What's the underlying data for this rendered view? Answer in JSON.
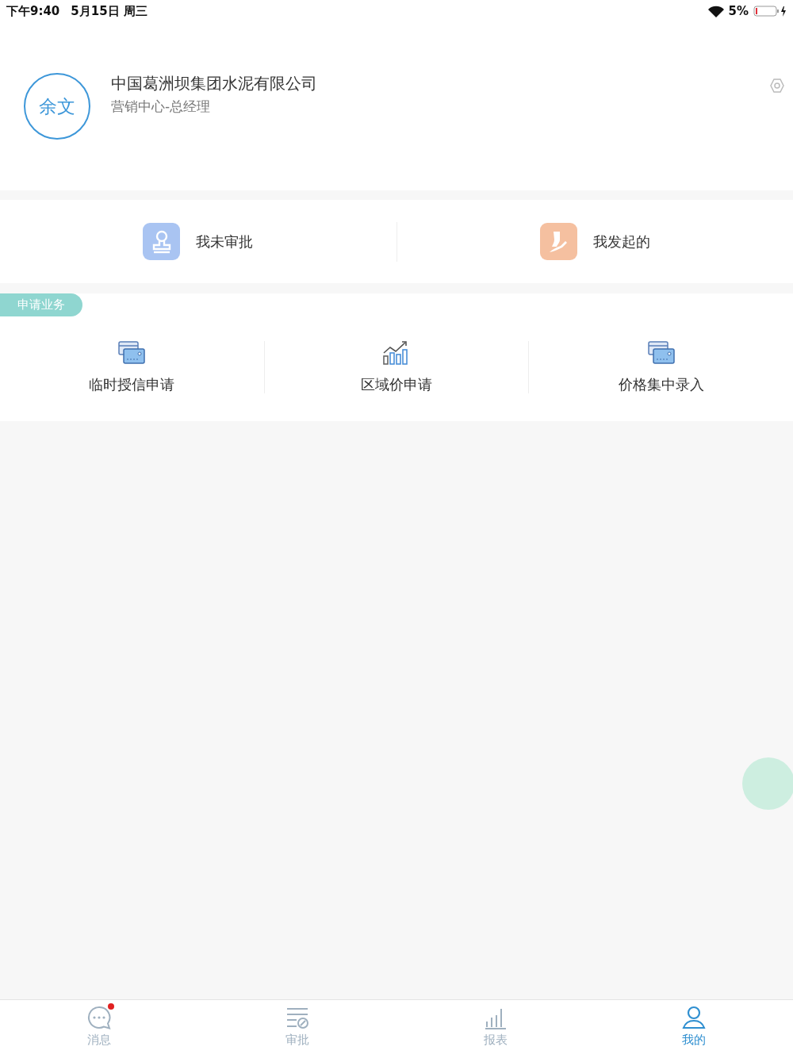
{
  "status_bar": {
    "time": "下午9:40",
    "date": "5月15日 周三",
    "battery": "5%"
  },
  "profile": {
    "avatar": "余文",
    "company": "中国葛洲坝集团水泥有限公司",
    "role": "营销中心-总经理"
  },
  "shortcuts": [
    {
      "label": "我未审批",
      "kind": "stamp",
      "color": "#a9c4f2"
    },
    {
      "label": "我发起的",
      "kind": "person",
      "color": "#f5c0a0"
    }
  ],
  "section": {
    "title": "申请业务",
    "items": [
      {
        "label": "临时授信申请",
        "kind": "card"
      },
      {
        "label": "区域价申请",
        "kind": "chart"
      },
      {
        "label": "价格集中录入",
        "kind": "card"
      }
    ]
  },
  "tab_bar": [
    {
      "label": "消息",
      "kind": "chat",
      "selected": false,
      "badge": true
    },
    {
      "label": "审批",
      "kind": "approve",
      "selected": false,
      "badge": false
    },
    {
      "label": "报表",
      "kind": "bars",
      "selected": false,
      "badge": false
    },
    {
      "label": "我的",
      "kind": "user",
      "selected": true,
      "badge": false
    }
  ]
}
